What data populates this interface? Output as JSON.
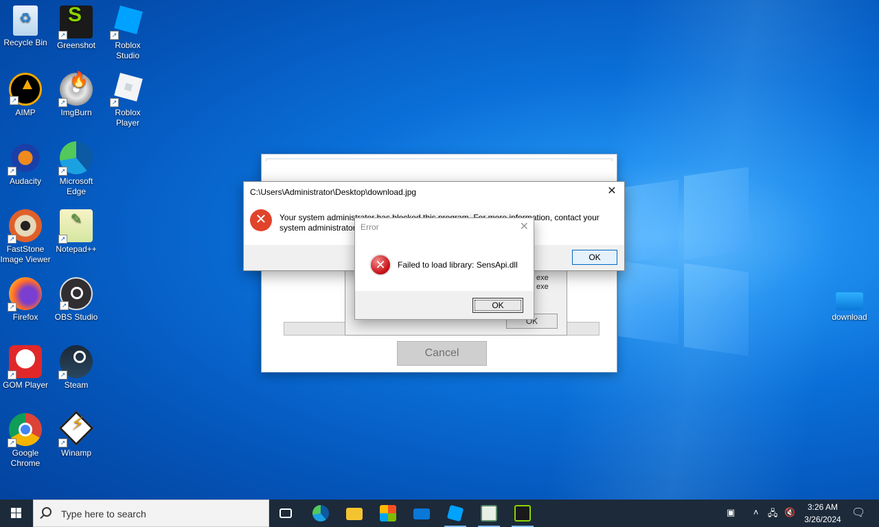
{
  "desktop": {
    "icons": [
      {
        "label": "Recycle Bin"
      },
      {
        "label": "Greenshot"
      },
      {
        "label": "Roblox Studio"
      },
      {
        "label": "AIMP"
      },
      {
        "label": "ImgBurn"
      },
      {
        "label": "Roblox Player"
      },
      {
        "label": "Audacity"
      },
      {
        "label": "Microsoft Edge"
      },
      {
        "label": "FastStone Image Viewer"
      },
      {
        "label": "Notepad++"
      },
      {
        "label": "Firefox"
      },
      {
        "label": "OBS Studio"
      },
      {
        "label": "GOM Player"
      },
      {
        "label": "Steam"
      },
      {
        "label": "Google Chrome"
      },
      {
        "label": "Winamp"
      },
      {
        "label": "download"
      }
    ]
  },
  "background_window": {
    "cancel_label": "Cancel"
  },
  "mid_dialog": {
    "line1": "exe",
    "line2": "exe",
    "ok_label": "OK"
  },
  "blocked_dialog": {
    "title": "C:\\Users\\Administrator\\Desktop\\download.jpg",
    "message": "Your system administrator has blocked this program. For more information, contact your system administrator.",
    "ok_label": "OK",
    "close_glyph": "✕"
  },
  "error_dialog": {
    "title": "Error",
    "message": "Failed to load library: SensApi.dll",
    "ok_label": "OK",
    "close_glyph": "✕"
  },
  "taskbar": {
    "search_placeholder": "Type here to search",
    "clock_time": "3:26 AM",
    "clock_date": "3/26/2024",
    "apps": [
      "task-view",
      "edge",
      "file-explorer",
      "microsoft-store",
      "mail",
      "roblox-studio",
      "notepad",
      "greenshot"
    ]
  },
  "colors": {
    "error_red": "#c8141a",
    "blocked_icon_orange": "#e0442a",
    "taskbar_bg": "#1c2a3a",
    "desktop_blue": "#0a6fd8"
  }
}
